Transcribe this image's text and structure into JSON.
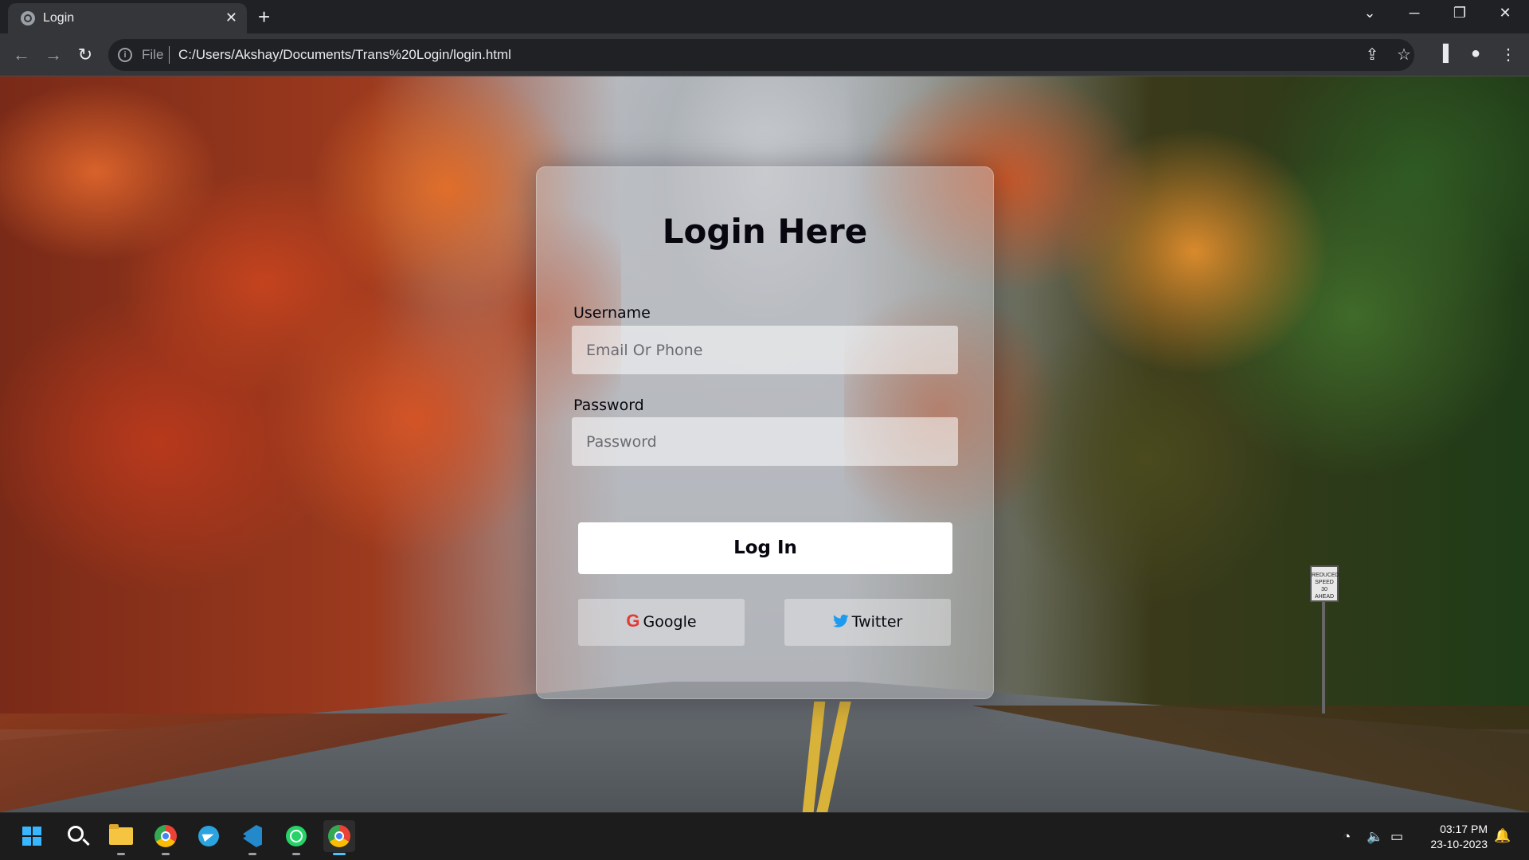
{
  "browser": {
    "tab_title": "Login",
    "tab_close": "✕",
    "new_tab": "+",
    "scheme_label": "File",
    "url": "C:/Users/Akshay/Documents/Trans%20Login/login.html"
  },
  "login_card": {
    "title": "Login Here",
    "username_label": "Username",
    "username_placeholder": "Email Or Phone",
    "password_label": "Password",
    "password_placeholder": "Password",
    "login_button": "Log In",
    "google_button": "Google",
    "google_icon_glyph": "G",
    "twitter_button": "Twitter"
  },
  "background_sign": {
    "text": "REDUCED SPEED 30 AHEAD"
  },
  "taskbar": {
    "apps": [
      "windows-start",
      "search",
      "file-explorer",
      "chrome",
      "telegram",
      "vscode",
      "whatsapp",
      "chrome-active"
    ],
    "time": "03:17 PM",
    "date": "23-10-2023"
  },
  "colors": {
    "title_text": "#080710",
    "google_red": "#e53935",
    "twitter_blue": "#1d9bf0",
    "taskbar_active_indicator": "#4cc2ff"
  }
}
